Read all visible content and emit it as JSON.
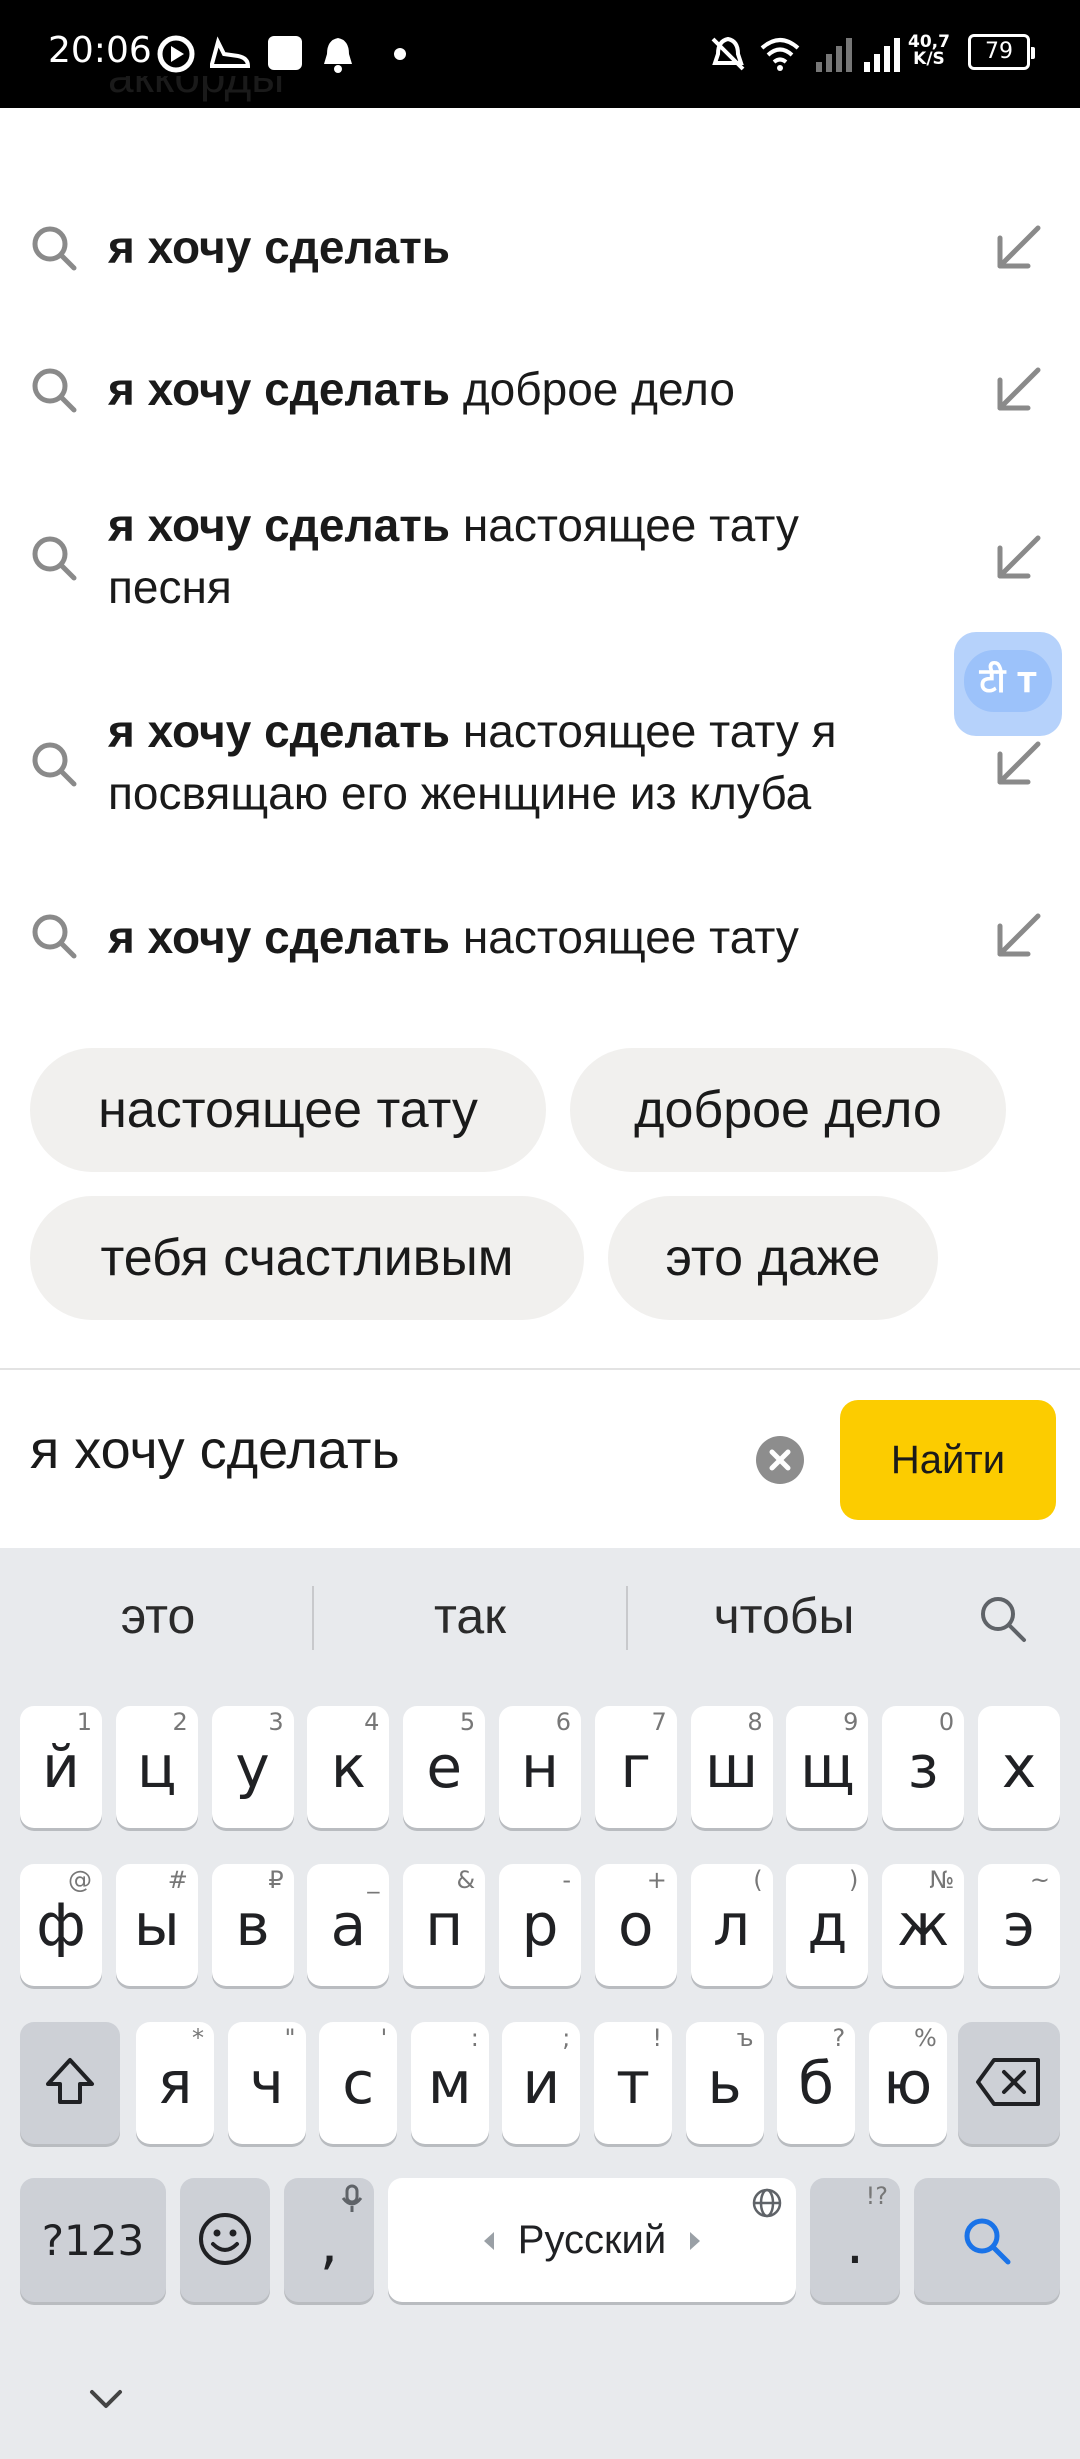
{
  "status_bar": {
    "time": "20:06",
    "network_speed_value": "40,7",
    "network_speed_unit": "K/S",
    "battery": "79"
  },
  "top_cut_text": "аккорды",
  "suggestions": [
    {
      "bold": "я хочу сделать",
      "rest": ""
    },
    {
      "bold": "я хочу сделать",
      "rest": " доброе дело"
    },
    {
      "bold": "я хочу сделать",
      "rest": " настоящее тату песня"
    },
    {
      "bold": "я хочу сделать",
      "rest": " настоящее тату я посвящаю его женщине из клуба"
    },
    {
      "bold": "я хочу сделать",
      "rest": " настоящее тату"
    }
  ],
  "translate_bubble": {
    "glyph_1": "टी",
    "glyph_2": "T"
  },
  "chips": [
    "настоящее тату",
    "доброе дело",
    "тебя счастливым",
    "это даже"
  ],
  "search": {
    "query": "я хочу сделать",
    "submit_label": "Найти"
  },
  "keyboard": {
    "predictions": [
      "это",
      "так",
      "чтобы"
    ],
    "row1": [
      {
        "key": "й",
        "hint": "1"
      },
      {
        "key": "ц",
        "hint": "2"
      },
      {
        "key": "у",
        "hint": "3"
      },
      {
        "key": "к",
        "hint": "4"
      },
      {
        "key": "е",
        "hint": "5"
      },
      {
        "key": "н",
        "hint": "6"
      },
      {
        "key": "г",
        "hint": "7"
      },
      {
        "key": "ш",
        "hint": "8"
      },
      {
        "key": "щ",
        "hint": "9"
      },
      {
        "key": "з",
        "hint": "0"
      },
      {
        "key": "х",
        "hint": ""
      }
    ],
    "row2": [
      {
        "key": "ф",
        "hint": "@"
      },
      {
        "key": "ы",
        "hint": "#"
      },
      {
        "key": "в",
        "hint": "₽"
      },
      {
        "key": "а",
        "hint": "_"
      },
      {
        "key": "п",
        "hint": "&"
      },
      {
        "key": "р",
        "hint": "-"
      },
      {
        "key": "о",
        "hint": "+"
      },
      {
        "key": "л",
        "hint": "("
      },
      {
        "key": "д",
        "hint": ")"
      },
      {
        "key": "ж",
        "hint": "№"
      },
      {
        "key": "э",
        "hint": "~"
      }
    ],
    "row3": [
      {
        "key": "я",
        "hint": "*"
      },
      {
        "key": "ч",
        "hint": "\""
      },
      {
        "key": "с",
        "hint": "'"
      },
      {
        "key": "м",
        "hint": ":"
      },
      {
        "key": "и",
        "hint": ";"
      },
      {
        "key": "т",
        "hint": "!"
      },
      {
        "key": "ь",
        "hint": "ъ"
      },
      {
        "key": "б",
        "hint": "?"
      },
      {
        "key": "ю",
        "hint": "%"
      }
    ],
    "symbols_key": "?123",
    "comma_key": ",",
    "space_label": "Русский",
    "period_key": ".",
    "period_hint": "!?"
  },
  "colors": {
    "accent_yellow": "#fccc00",
    "keyboard_bg": "#e8eaed",
    "chip_bg": "#f1f0ee",
    "search_key_blue": "#1a73e8"
  }
}
